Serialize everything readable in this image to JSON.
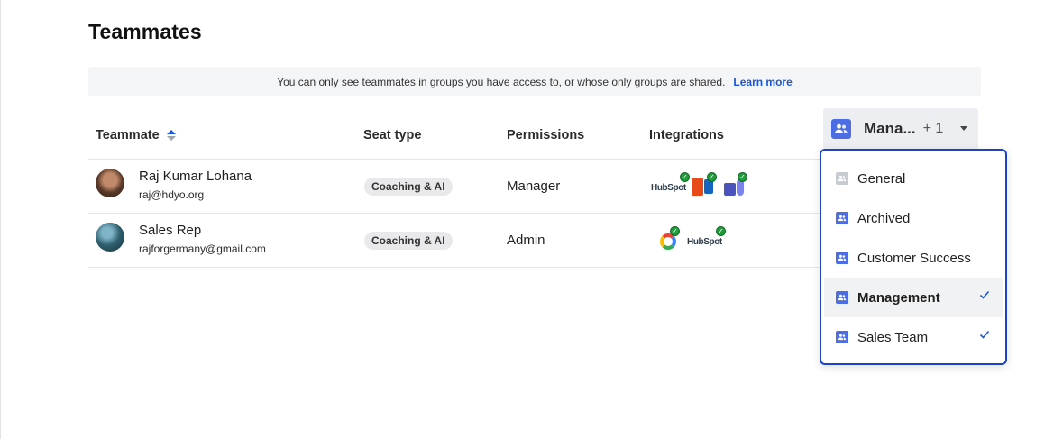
{
  "page": {
    "title": "Teammates"
  },
  "notice": {
    "text": "You can only see teammates in groups you have access to, or whose only groups are shared.",
    "link": "Learn more"
  },
  "table": {
    "columns": {
      "teammate": "Teammate",
      "seat_type": "Seat type",
      "permissions": "Permissions",
      "integrations": "Integrations"
    },
    "rows": [
      {
        "name": "Raj Kumar Lohana",
        "email": "raj@hdyo.org",
        "seat_type": "Coaching & AI",
        "permission": "Manager",
        "integrations": [
          "HubSpot",
          "Office 365",
          "Microsoft Teams"
        ]
      },
      {
        "name": "Sales Rep",
        "email": "rajforgermany@gmail.com",
        "seat_type": "Coaching & AI",
        "permission": "Admin",
        "integrations": [
          "Google",
          "HubSpot"
        ]
      }
    ]
  },
  "integration_labels": {
    "hubspot": "HubSpot"
  },
  "group_filter": {
    "label": "Mana...",
    "extra_count": "+ 1",
    "options": [
      {
        "label": "General",
        "selected": false,
        "icon": "group-icon-gray"
      },
      {
        "label": "Archived",
        "selected": false,
        "icon": "group-icon"
      },
      {
        "label": "Customer Success",
        "selected": false,
        "icon": "group-icon"
      },
      {
        "label": "Management",
        "selected": true,
        "icon": "group-icon"
      },
      {
        "label": "Sales Team",
        "selected": true,
        "icon": "group-icon"
      }
    ]
  },
  "colors": {
    "accent": "#1a56db",
    "group_icon": "#4d6ee3",
    "dropdown_border": "#1a44c7",
    "connected": "#1f9d3a"
  }
}
